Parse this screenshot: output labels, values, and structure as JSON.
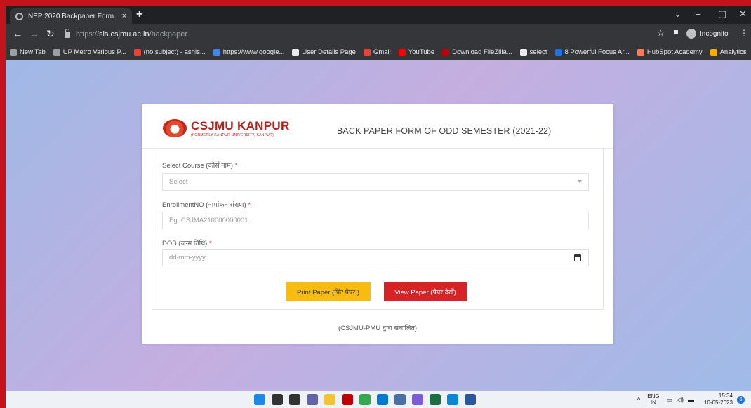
{
  "browser": {
    "tab_title": "NEP 2020 Backpaper Form",
    "tab_close": "×",
    "new_tab": "+",
    "url_scheme": "https://",
    "url_host": "sis.csjmu.ac.in",
    "url_path": "/backpaper",
    "profile_label": "Incognito",
    "window_controls": [
      "⌄",
      "–",
      "▢",
      "✕"
    ],
    "bookmarks": [
      {
        "label": "New Tab",
        "icon": "globe-icon",
        "color": "#9aa0a6"
      },
      {
        "label": "UP Metro Various P...",
        "icon": "page-icon",
        "color": "#9aa0a6"
      },
      {
        "label": "(no subject) - ashis...",
        "icon": "gmail-icon",
        "color": "#ea4335"
      },
      {
        "label": "https://www.google...",
        "icon": "google-icon",
        "color": "#4285f4"
      },
      {
        "label": "User Details Page",
        "icon": "page-icon",
        "color": "#e8eaed"
      },
      {
        "label": "Gmail",
        "icon": "gmail-icon",
        "color": "#ea4335"
      },
      {
        "label": "YouTube",
        "icon": "youtube-icon",
        "color": "#ff0000"
      },
      {
        "label": "Download FileZilla...",
        "icon": "filezilla-icon",
        "color": "#bf0000"
      },
      {
        "label": "select",
        "icon": "select-icon",
        "color": "#e8eaed"
      },
      {
        "label": "8 Powerful Focus Ar...",
        "icon": "page-icon",
        "color": "#1a73e8"
      },
      {
        "label": "HubSpot Academy",
        "icon": "hubspot-icon",
        "color": "#ff7a59"
      },
      {
        "label": "Analytics",
        "icon": "analytics-icon",
        "color": "#f9ab00"
      }
    ],
    "bookmarks_more": "»"
  },
  "page": {
    "logo_text": "CSJMU KANPUR",
    "logo_subtext": "(FORMERLY KANPUR UNIVERSITY, KANPUR)",
    "form_title": "BACK PAPER FORM OF ODD SEMESTER (2021-22)",
    "course": {
      "label": "Select Course (कोर्स नाम)",
      "required": "*",
      "value": "Select"
    },
    "enrollment": {
      "label": "EnrollmentNO (नामांकन संख्या)",
      "required": "*",
      "placeholder": "Eg: CSJMA210000000001"
    },
    "dob": {
      "label": "DOB (जन्म तिथि)",
      "required": "*",
      "placeholder": "dd-mm-yyyy"
    },
    "print_button": "Print Paper (प्रिंट पेपर )",
    "view_button": "View Paper (पेपर देखें)",
    "footer": "(CSJMU-PMU द्वारा संचालित)",
    "colors": {
      "print": "#f7bc0f",
      "view": "#d72226",
      "logo": "#b5201b"
    }
  },
  "taskbar": {
    "apps": [
      {
        "icon": "windows-start-icon",
        "color": "#1e88e5"
      },
      {
        "icon": "search-icon",
        "color": "#333333"
      },
      {
        "icon": "task-view-icon",
        "color": "#333333"
      },
      {
        "icon": "chat-icon",
        "color": "#6264a7"
      },
      {
        "icon": "file-explorer-icon",
        "color": "#f4c430"
      },
      {
        "icon": "filezilla-icon",
        "color": "#bf0000"
      },
      {
        "icon": "chrome-icon",
        "color": "#34a853"
      },
      {
        "icon": "vscode-icon",
        "color": "#007acc"
      },
      {
        "icon": "settings-icon",
        "color": "#4a6fa5"
      },
      {
        "icon": "paint-icon",
        "color": "#7b5cd6"
      },
      {
        "icon": "excel-icon",
        "color": "#1d6f42"
      },
      {
        "icon": "edge-icon",
        "color": "#0c87d4"
      },
      {
        "icon": "word-icon",
        "color": "#2b579a"
      }
    ],
    "lang_top": "ENG",
    "lang_bottom": "IN",
    "time": "15:34",
    "date": "10-05-2023",
    "notification_count": "6"
  }
}
